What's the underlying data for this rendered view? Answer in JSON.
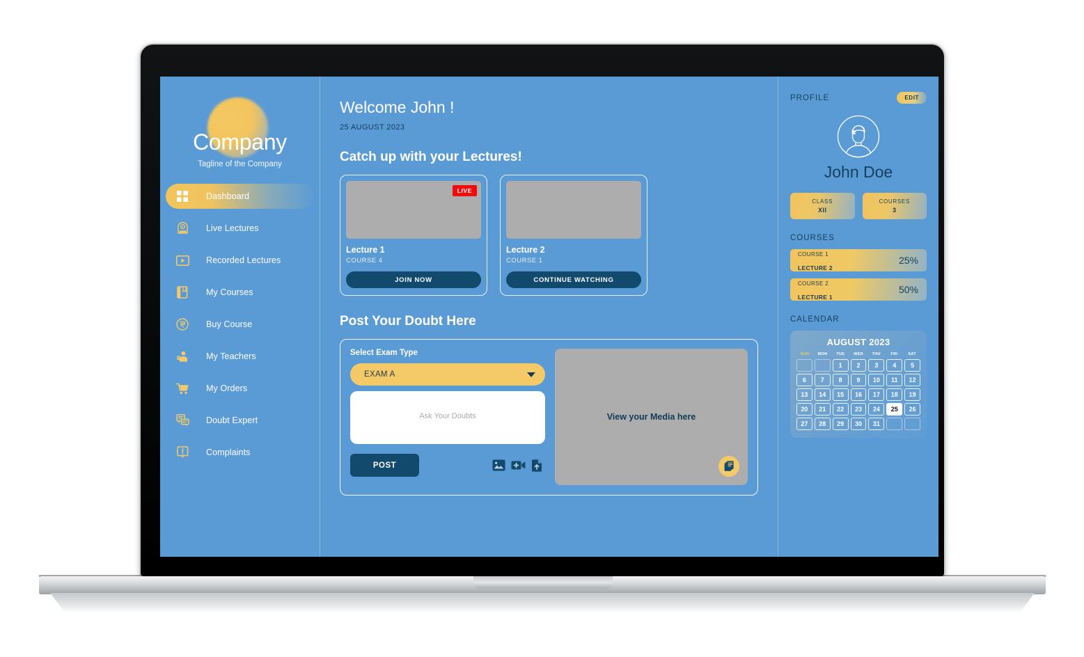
{
  "sidebar": {
    "brand": {
      "name": "Company",
      "tagline": "Tagline of the Company"
    },
    "items": [
      {
        "label": "Dashboard",
        "icon": "dashboard-grid-icon",
        "active": true
      },
      {
        "label": "Live Lectures",
        "icon": "live-video-icon",
        "active": false
      },
      {
        "label": "Recorded Lectures",
        "icon": "play-rect-icon",
        "active": false
      },
      {
        "label": "My Courses",
        "icon": "book-icon",
        "active": false
      },
      {
        "label": "Buy Course",
        "icon": "rupee-circle-icon",
        "active": false
      },
      {
        "label": "My Teachers",
        "icon": "teacher-icon",
        "active": false
      },
      {
        "label": "My Orders",
        "icon": "shopping-cart-icon",
        "active": false
      },
      {
        "label": "Doubt Expert",
        "icon": "chat-bubbles-icon",
        "active": false
      },
      {
        "label": "Complaints",
        "icon": "complaint-icon",
        "active": false
      }
    ]
  },
  "main": {
    "welcome_title": "Welcome John !",
    "date": "25 AUGUST 2023",
    "lectures_heading": "Catch up with your Lectures!",
    "lectures": [
      {
        "name": "Lecture 1",
        "course": "COURSE 4",
        "button": "JOIN NOW",
        "live": true,
        "live_label": "LIVE"
      },
      {
        "name": "Lecture 2",
        "course": "COURSE 1",
        "button": "CONTINUE WATCHING",
        "live": false,
        "live_label": ""
      }
    ],
    "doubt": {
      "heading": "Post Your Doubt Here",
      "select_label": "Select Exam Type",
      "exam_selected": "EXAM A",
      "exam_options": [
        "EXAM A"
      ],
      "textarea_placeholder": "Ask Your Doubts",
      "textarea_value": "",
      "post_label": "POST",
      "attach_icons": [
        "image-icon",
        "video-add-icon",
        "file-upload-icon"
      ],
      "media_placeholder": "View your Media here",
      "media_fab_icon": "documents-icon"
    }
  },
  "right_panel": {
    "profile_title": "PROFILE",
    "edit_label": "EDIT",
    "avatar_icon": "user-avatar-icon",
    "name": "John Doe",
    "stats": [
      {
        "label": "CLASS",
        "value": "XII"
      },
      {
        "label": "COURSES",
        "value": "3"
      }
    ],
    "courses_title": "COURSES",
    "courses": [
      {
        "course": "COURSE 1",
        "lecture": "LECTURE 2",
        "percent": "25%"
      },
      {
        "course": "COURSE 2",
        "lecture": "LECTURE 1",
        "percent": "50%"
      }
    ],
    "calendar_title": "CALENDAR",
    "calendar": {
      "month_year": "AUGUST 2023",
      "dow": [
        "SUN",
        "MON",
        "TUE",
        "WED",
        "THU",
        "FRI",
        "SAT"
      ],
      "lead_blanks": 2,
      "days": 31,
      "today": 25,
      "trail_blanks": 2
    }
  },
  "colors": {
    "app_background": "#5b9bd5",
    "accent_yellow": "#f2c45e",
    "navy": "#124a6e",
    "dark_text": "#15405f",
    "live_red": "#f20d0d",
    "placeholder_grey": "#adadad",
    "white": "#ffffff"
  }
}
